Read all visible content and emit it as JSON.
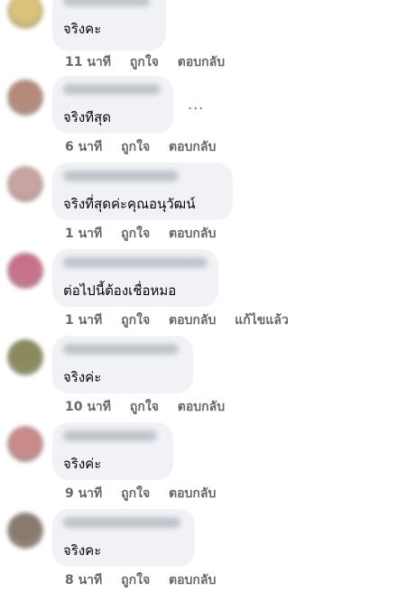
{
  "comments": [
    {
      "text": "จริงคะ",
      "time": "11 นาที",
      "like": "ถูกใจ",
      "reply": "ตอบกลับ",
      "avatar_color": "#d9c27a"
    },
    {
      "text": "จริงทีสุด",
      "time": "6 นาที",
      "like": "ถูกใจ",
      "reply": "ตอบกลับ",
      "more": "...",
      "avatar_color": "#b58a7a"
    },
    {
      "text": "จริงที่สุดค่ะคุณอนุวัฒน์",
      "time": "1 นาที",
      "like": "ถูกใจ",
      "reply": "ตอบกลับ",
      "avatar_color": "#c9a3a0"
    },
    {
      "text": "ต่อไปนี้ต้องเชื่อหมอ",
      "time": "1 นาที",
      "like": "ถูกใจ",
      "reply": "ตอบกลับ",
      "edited": "แก้ไขแล้ว",
      "avatar_color": "#c8728a"
    },
    {
      "text": "จริงค่ะ",
      "time": "10 นาที",
      "like": "ถูกใจ",
      "reply": "ตอบกลับ",
      "avatar_color": "#8a8a5e"
    },
    {
      "text": "จริงค่ะ",
      "time": "9 นาที",
      "like": "ถูกใจ",
      "reply": "ตอบกลับ",
      "avatar_color": "#c98a8a"
    },
    {
      "text": "จริงคะ",
      "time": "8 นาที",
      "like": "ถูกใจ",
      "reply": "ตอบกลับ",
      "avatar_color": "#8a7a6e"
    }
  ]
}
